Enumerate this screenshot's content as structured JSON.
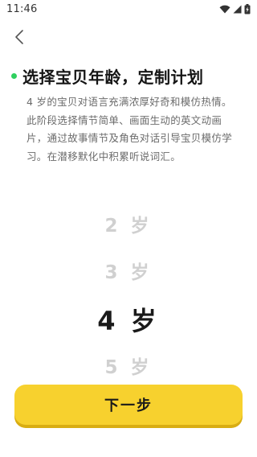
{
  "status_bar": {
    "time": "11:46",
    "icons": [
      "wifi-icon",
      "cellular-signal-icon",
      "battery-charging-icon"
    ]
  },
  "header": {
    "back_icon": "chevron-left-icon"
  },
  "main": {
    "title": "选择宝贝年龄，定制计划",
    "description": "4 岁的宝贝对语言充满浓厚好奇和模仿热情。此阶段选择情节简单、画面生动的英文动画片，通过故事情节及角色对话引导宝贝模仿学习。在潜移默化中积累听说词汇。"
  },
  "age_picker": {
    "options": [
      {
        "label": "2 岁",
        "selected": false
      },
      {
        "label": "3 岁",
        "selected": false
      },
      {
        "label": "4 岁",
        "selected": true
      },
      {
        "label": "5 岁",
        "selected": false
      }
    ],
    "selected_value": "4 岁"
  },
  "footer": {
    "next_label": "下一步"
  },
  "colors": {
    "accent_button": "#f7d12e",
    "title_dot": "#2fd05f",
    "unselected_option": "#d0d0d0",
    "selected_option": "#1a1a1a",
    "description_text": "#6b6b6b"
  }
}
